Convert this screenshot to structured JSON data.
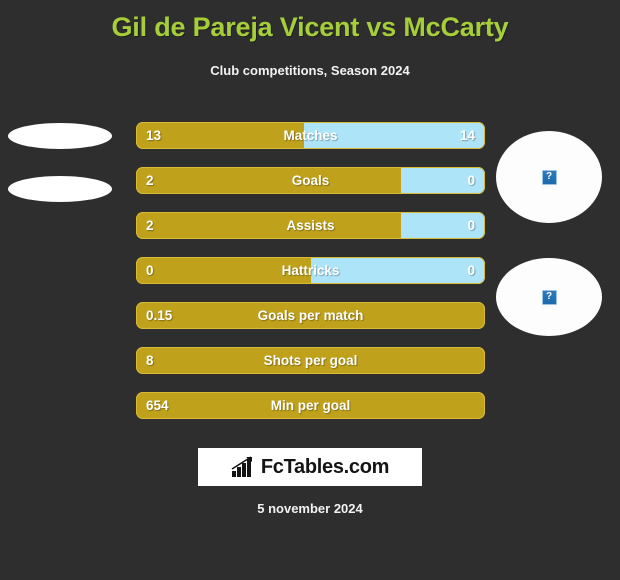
{
  "header": {
    "title": "Gil de Pareja Vicent vs McCarty",
    "subtitle": "Club competitions, Season 2024",
    "title_color": "#a6ce39"
  },
  "avatars": {
    "left_player_icon": "player-photo-placeholder",
    "right_player_icon": "broken-image-placeholder",
    "broken_glyph": "?"
  },
  "footer": {
    "logo_text": "FcTables.com",
    "logo_icon": "bar-chart-icon",
    "date": "5 november 2024"
  },
  "chart_data": {
    "type": "bar",
    "title": "Gil de Pareja Vicent vs McCarty",
    "subtitle": "Club competitions, Season 2024",
    "orientation": "horizontal-diverging",
    "legend": [
      "Gil de Pareja Vicent",
      "McCarty"
    ],
    "colors": {
      "left": "#bfa11c",
      "right": "#aee4f7",
      "background": "#2e2e2e",
      "title": "#a6ce39",
      "text": "#ffffff"
    },
    "categories": [
      "Matches",
      "Goals",
      "Assists",
      "Hattricks",
      "Goals per match",
      "Shots per goal",
      "Min per goal"
    ],
    "series": [
      {
        "name": "Gil de Pareja Vicent",
        "values": [
          13,
          2,
          2,
          0,
          0.15,
          8,
          654
        ]
      },
      {
        "name": "McCarty",
        "values": [
          14,
          0,
          0,
          0,
          null,
          null,
          null
        ]
      }
    ],
    "rows": [
      {
        "label": "Matches",
        "left": "13",
        "right": "14",
        "left_pct": 48,
        "has_right": true
      },
      {
        "label": "Goals",
        "left": "2",
        "right": "0",
        "left_pct": 76,
        "has_right": true
      },
      {
        "label": "Assists",
        "left": "2",
        "right": "0",
        "left_pct": 76,
        "has_right": true
      },
      {
        "label": "Hattricks",
        "left": "0",
        "right": "0",
        "left_pct": 50,
        "has_right": true
      },
      {
        "label": "Goals per match",
        "left": "0.15",
        "right": "",
        "left_pct": 100,
        "has_right": false
      },
      {
        "label": "Shots per goal",
        "left": "8",
        "right": "",
        "left_pct": 100,
        "has_right": false
      },
      {
        "label": "Min per goal",
        "left": "654",
        "right": "",
        "left_pct": 100,
        "has_right": false
      }
    ]
  }
}
